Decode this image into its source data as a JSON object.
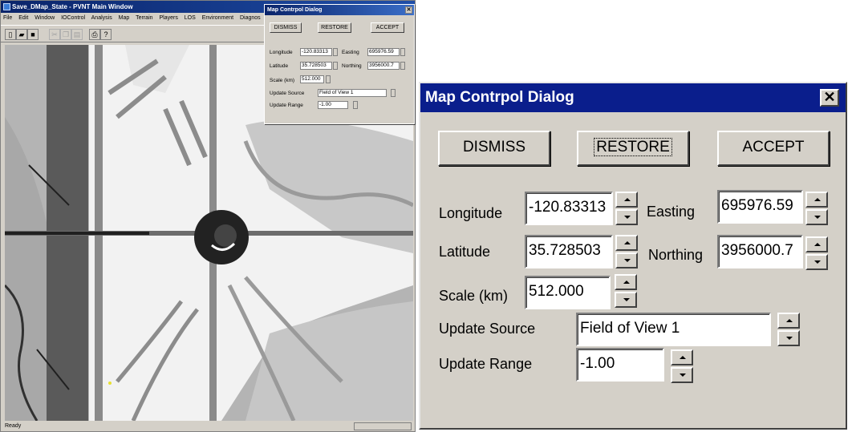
{
  "main_window": {
    "title": "Save_DMap_State - PVNT Main Window",
    "menu": [
      "File",
      "Edit",
      "Window",
      "IOControl",
      "Analysis",
      "Map",
      "Terrain",
      "Players",
      "LOS",
      "Environment",
      "Diagnos"
    ],
    "status": "Ready"
  },
  "dialog": {
    "title": "Map Contrpol Dialog",
    "close_glyph": "✕",
    "buttons": {
      "dismiss": "DISMISS",
      "restore": "RESTORE",
      "accept": "ACCEPT"
    },
    "labels": {
      "longitude": "Longitude",
      "latitude": "Latitude",
      "scale": "Scale (km)",
      "easting": "Easting",
      "northing": "Northing",
      "update_source": "Update Source",
      "update_range": "Update Range"
    },
    "values": {
      "longitude": "-120.83313",
      "latitude": "35.728503",
      "scale": "512.000",
      "easting": "695976.59",
      "northing": "3956000.7",
      "update_source": "Field of View 1",
      "update_range": "-1.00"
    },
    "small_labels": {
      "longitude": "Longitude",
      "latitude": "Latitude",
      "scale": "Scale (km)",
      "easting": "Easting",
      "northing": "Northing"
    },
    "small_values": {
      "longitude": "-120.83313",
      "latitude": "35.728503",
      "easting": "695976.59",
      "northing": "3956000.7"
    }
  }
}
